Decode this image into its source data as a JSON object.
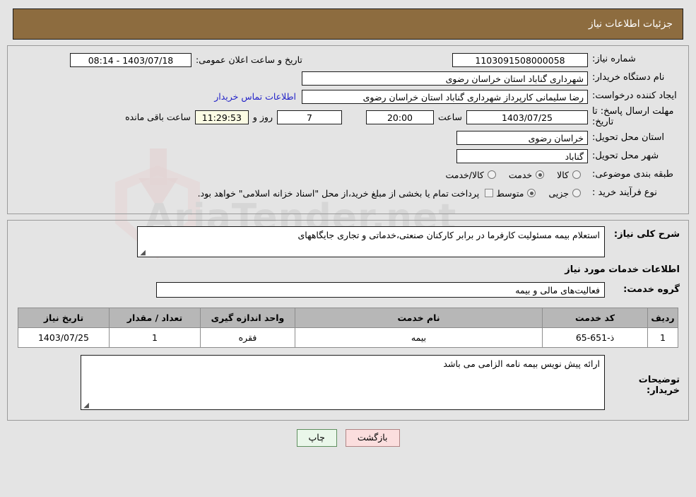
{
  "header": {
    "title": "جزئیات اطلاعات نیاز"
  },
  "top": {
    "need_number_label": "شماره نیاز:",
    "need_number_value": "1103091508000058",
    "announce_label": "تاریخ و ساعت اعلان عمومی:",
    "announce_value": "1403/07/18 - 08:14",
    "buyer_org_label": "نام دستگاه خریدار:",
    "buyer_org_value": "شهرداری گناباد استان خراسان رضوی",
    "creator_label": "ایجاد کننده درخواست:",
    "creator_value": "رضا سلیمانی کارپرداز شهرداری گناباد استان خراسان رضوی",
    "contact_link": "اطلاعات تماس خریدار",
    "deadline_label": "مهلت ارسال پاسخ: تا تاریخ:",
    "deadline_date": "1403/07/25",
    "hour_label": "ساعت",
    "deadline_time": "20:00",
    "days_value": "7",
    "days_label": "روز و",
    "remaining_clock": "11:29:53",
    "remaining_label": "ساعت باقی مانده",
    "province_label": "استان محل تحویل:",
    "province_value": "خراسان رضوی",
    "city_label": "شهر محل تحویل:",
    "city_value": "گناباد",
    "category_label": "طبقه بندی موضوعی:",
    "category_options": [
      {
        "label": "کالا",
        "selected": false
      },
      {
        "label": "خدمت",
        "selected": true
      },
      {
        "label": "کالا/خدمت",
        "selected": false
      }
    ],
    "process_label": "نوع فرآیند خرید :",
    "process_options": [
      {
        "label": "جزیی",
        "selected": false
      },
      {
        "label": "متوسط",
        "selected": true
      }
    ],
    "treasury_note": "پرداخت تمام یا بخشی از مبلغ خرید،از محل \"اسناد خزانه اسلامی\" خواهد بود.",
    "treasury_checked": false
  },
  "middle": {
    "need_desc_label": "شرح کلی نیاز:",
    "need_desc_value": "استعلام بیمه مسئولیت کارفرما در برابر کارکنان صنعتی،خدماتی و تجاری جایگاههای",
    "section_title": "اطلاعات خدمات مورد نیاز",
    "service_group_label": "گروه خدمت:",
    "service_group_value": "فعالیت‌های مالی و بیمه"
  },
  "table": {
    "columns": [
      "ردیف",
      "کد خدمت",
      "نام خدمت",
      "واحد اندازه گیری",
      "تعداد / مقدار",
      "تاریخ نیاز"
    ],
    "rows": [
      {
        "radif": "1",
        "code": "ذ-651-65",
        "name": "بیمه",
        "unit": "فقره",
        "qty": "1",
        "date": "1403/07/25"
      }
    ]
  },
  "notes": {
    "label": "توضیحات خریدار:",
    "value": "ارائه پیش نویس بیمه نامه الزامی می باشد"
  },
  "footer": {
    "print_label": "چاپ",
    "back_label": "بازگشت"
  },
  "watermark": {
    "text": "AriaTender.net"
  },
  "colors": {
    "header_bg": "#8d6c3f",
    "page_bg": "#e4e4e4",
    "link": "#2323c8",
    "table_header_bg": "#b7b7b7",
    "print_btn_bg": "#eaf7ea",
    "back_btn_bg": "#fbdede",
    "clock_field_bg": "#fbfbe4"
  }
}
